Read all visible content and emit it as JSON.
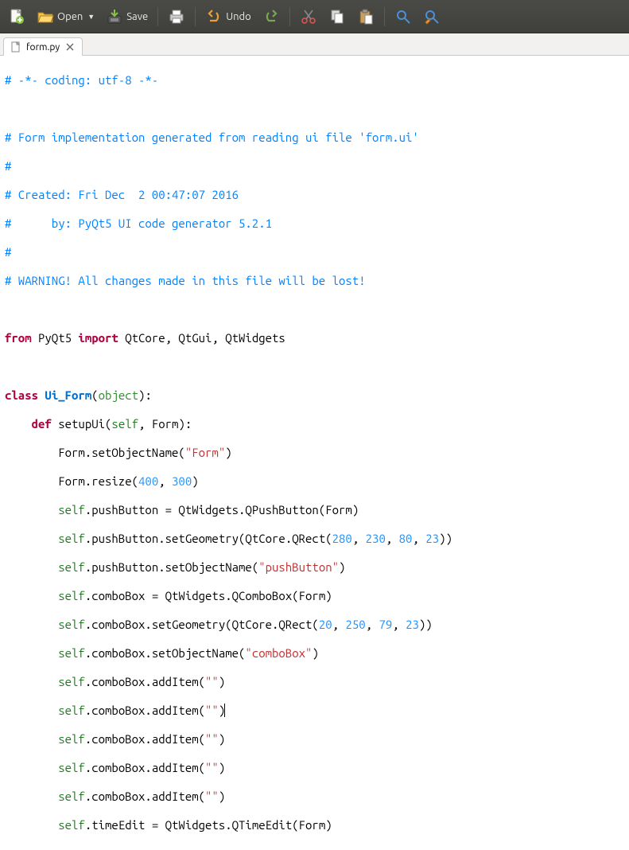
{
  "toolbar": {
    "new_label": "",
    "open_label": "Open",
    "save_label": "Save",
    "print_label": "",
    "undo_label": "Undo",
    "redo_label": "",
    "cut_label": "",
    "copy_label": "",
    "paste_label": "",
    "find_label": "",
    "replace_label": ""
  },
  "tabs": [
    {
      "filename": "form.py"
    }
  ],
  "code": {
    "l1": {
      "a": "# -*- coding: utf-8 -*-"
    },
    "l2": {
      "a": ""
    },
    "l3": {
      "a": "# Form implementation generated from reading ui file 'form.ui'"
    },
    "l4": {
      "a": "#"
    },
    "l5": {
      "a": "# Created: Fri Dec  2 00:47:07 2016"
    },
    "l6": {
      "a": "#      by: PyQt5 UI code generator 5.2.1"
    },
    "l7": {
      "a": "#"
    },
    "l8": {
      "a": "# WARNING! All changes made in this file will be lost!"
    },
    "l9": {
      "a": ""
    },
    "l10": {
      "a": "from",
      "b": " PyQt5 ",
      "c": "import",
      "d": " QtCore, QtGui, QtWidgets"
    },
    "l11": {
      "a": ""
    },
    "l12": {
      "a": "class",
      "b": " ",
      "c": "Ui_Form",
      "d": "(",
      "e": "object",
      "f": "):"
    },
    "l13": {
      "a": "    ",
      "b": "def",
      "c": " setupUi(",
      "d": "self",
      "e": ", Form):"
    },
    "l14": {
      "a": "        Form.setObjectName(",
      "b": "\"Form\"",
      "c": ")"
    },
    "l15": {
      "a": "        Form.resize(",
      "b": "400",
      "c": ", ",
      "d": "300",
      "e": ")"
    },
    "l16": {
      "a": "        ",
      "b": "self",
      "c": ".pushButton = QtWidgets.QPushButton(Form)"
    },
    "l17": {
      "a": "        ",
      "b": "self",
      "c": ".pushButton.setGeometry(QtCore.QRect(",
      "d": "280",
      "e": ", ",
      "f": "230",
      "g": ", ",
      "h": "80",
      "i": ", ",
      "j": "23",
      "k": "))"
    },
    "l18": {
      "a": "        ",
      "b": "self",
      "c": ".pushButton.setObjectName(",
      "d": "\"pushButton\"",
      "e": ")"
    },
    "l19": {
      "a": "        ",
      "b": "self",
      "c": ".comboBox = QtWidgets.QComboBox(Form)"
    },
    "l20": {
      "a": "        ",
      "b": "self",
      "c": ".comboBox.setGeometry(QtCore.QRect(",
      "d": "20",
      "e": ", ",
      "f": "250",
      "g": ", ",
      "h": "79",
      "i": ", ",
      "j": "23",
      "k": "))"
    },
    "l21": {
      "a": "        ",
      "b": "self",
      "c": ".comboBox.setObjectName(",
      "d": "\"comboBox\"",
      "e": ")"
    },
    "l22": {
      "a": "        ",
      "b": "self",
      "c": ".comboBox.addItem(",
      "d": "\"\"",
      "e": ")"
    },
    "l23": {
      "a": "        ",
      "b": "self",
      "c": ".comboBox.addItem(",
      "d": "\"\"",
      "e": ")"
    },
    "l24": {
      "a": "        ",
      "b": "self",
      "c": ".comboBox.addItem(",
      "d": "\"\"",
      "e": ")"
    },
    "l25": {
      "a": "        ",
      "b": "self",
      "c": ".comboBox.addItem(",
      "d": "\"\"",
      "e": ")"
    },
    "l26": {
      "a": "        ",
      "b": "self",
      "c": ".comboBox.addItem(",
      "d": "\"\"",
      "e": ")"
    },
    "l27": {
      "a": "        ",
      "b": "self",
      "c": ".timeEdit = QtWidgets.QTimeEdit(Form)"
    }
  }
}
